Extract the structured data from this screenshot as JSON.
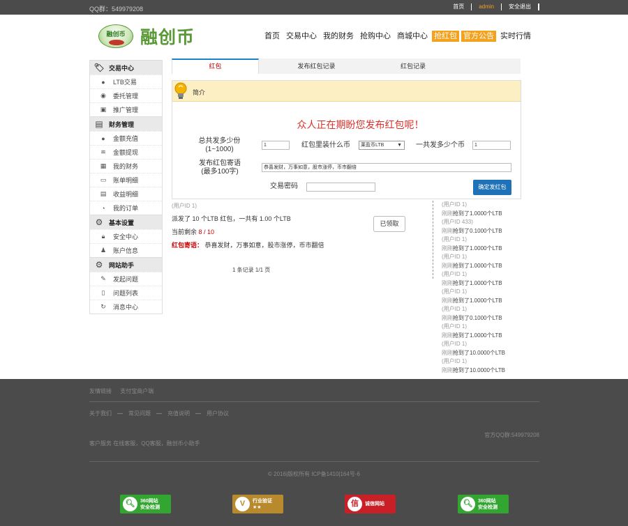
{
  "topbar": {
    "qq": "QQ群：549979208",
    "links": [
      "首页",
      "admin",
      "安全退出"
    ]
  },
  "logo": {
    "badge_text": "融创币",
    "name": "融创币"
  },
  "nav": [
    "首页",
    "交易中心",
    "我的财务",
    "抢购中心",
    "商城中心",
    "抢红包",
    "官方公告",
    "实时行情"
  ],
  "sidebar": {
    "sections": [
      {
        "title": "交易中心",
        "icon": "tag-icon",
        "items": [
          {
            "label": "LTB交易",
            "icon": "circle-icon"
          },
          {
            "label": "委托管理",
            "icon": "coin-icon"
          },
          {
            "label": "推广管理",
            "icon": "picture-icon"
          }
        ]
      },
      {
        "title": "财务管理",
        "icon": "book-icon",
        "items": [
          {
            "label": "金额充值",
            "icon": "circle-icon"
          },
          {
            "label": "金额提现",
            "icon": "money-icon"
          },
          {
            "label": "我的财务",
            "icon": "wallet-icon"
          },
          {
            "label": "账单明细",
            "icon": "monitor-icon"
          },
          {
            "label": "收益明细",
            "icon": "list-icon"
          },
          {
            "label": "我的订单",
            "icon": "pie-icon"
          }
        ]
      },
      {
        "title": "基本设置",
        "icon": "gear-icon",
        "items": [
          {
            "label": "安全中心",
            "icon": "lock-icon"
          },
          {
            "label": "账户信息",
            "icon": "user-icon"
          }
        ]
      },
      {
        "title": "网站助手",
        "icon": "gear-icon",
        "items": [
          {
            "label": "发起问题",
            "icon": "edit-icon"
          },
          {
            "label": "问题列表",
            "icon": "doc-icon"
          },
          {
            "label": "消息中心",
            "icon": "refresh-icon"
          }
        ]
      }
    ]
  },
  "tabs": [
    "红包",
    "发布红包记录",
    "红包记录"
  ],
  "panel": {
    "title": "简介",
    "slogan": "众人正在期盼您发布红包呢！",
    "total_label": "总共发多少份",
    "total_range": "(1~1000)",
    "total_value": "1",
    "coin_label": "红包里装什么币",
    "coin_value": "莱盈币LTB",
    "amount_label": "一共发多少个币",
    "amount_value": "1",
    "msg_label": "发布红包寄语",
    "msg_range": "(最多100字)",
    "msg_value": "恭喜发财，万事如意，股市涨停，币市翻倍",
    "pwd_label": "交易密码",
    "pwd_value": "",
    "confirm": "确定发红包"
  },
  "record": {
    "uid": "(用户ID 1)",
    "desc": "派发了 10 个LTB 红包，一共有 1.00 个LTB",
    "remain_label": "当前剩余",
    "remain_value": "8 / 10",
    "bless_label": "红包寄语：",
    "bless_value": "恭喜发财，万事如意，股市涨停，币市翻倍",
    "claimed": "已领取",
    "pager": "1 条记录 1/1 页"
  },
  "feed": [
    {
      "user": "(用户ID 1)",
      "text": "抢到了1.0000个LTB"
    },
    {
      "user": "(用户ID 433)",
      "text": "抢到了0.1000个LTB"
    },
    {
      "user": "(用户ID 1)",
      "text": "抢到了1.0000个LTB"
    },
    {
      "user": "(用户ID 1)",
      "text": "抢到了1.0000个LTB"
    },
    {
      "user": "(用户ID 1)",
      "text": "抢到了1.0000个LTB"
    },
    {
      "user": "(用户ID 1)",
      "text": "抢到了1.0000个LTB"
    },
    {
      "user": "(用户ID 1)",
      "text": "抢到了0.1000个LTB"
    },
    {
      "user": "(用户ID 1)",
      "text": "抢到了1.0000个LTB"
    },
    {
      "user": "(用户ID 1)",
      "text": "抢到了10.0000个LTB"
    },
    {
      "user": "(用户ID 1)",
      "text": "抢到了10.0000个LTB"
    }
  ],
  "feed_prefix": "刚刚",
  "footer": {
    "friend_label": "友情链接",
    "friend_link": "支付宝商户端",
    "links": [
      "关于我们",
      "常见问题",
      "充值说明",
      "用户协议"
    ],
    "qq": "官方QQ群:549979208",
    "service": "客户服务  在线客服，QQ客服，融创币小助手",
    "copyright": "© 2016|版权所有    ICP备1410|164号-6",
    "badges": [
      {
        "text1": "360网站",
        "text2": "安全检测",
        "icon": "magnifier-icon",
        "color": "#33a531"
      },
      {
        "text1": "行业验证",
        "text2": "★★",
        "icon": "v-check-icon",
        "color": "#b88a2d"
      },
      {
        "text1": "诚信网站",
        "text2": "",
        "icon": "xin-icon",
        "color": "#c91f26"
      },
      {
        "text1": "360网站",
        "text2": "安全检测",
        "icon": "magnifier-icon",
        "color": "#33a531"
      }
    ]
  }
}
